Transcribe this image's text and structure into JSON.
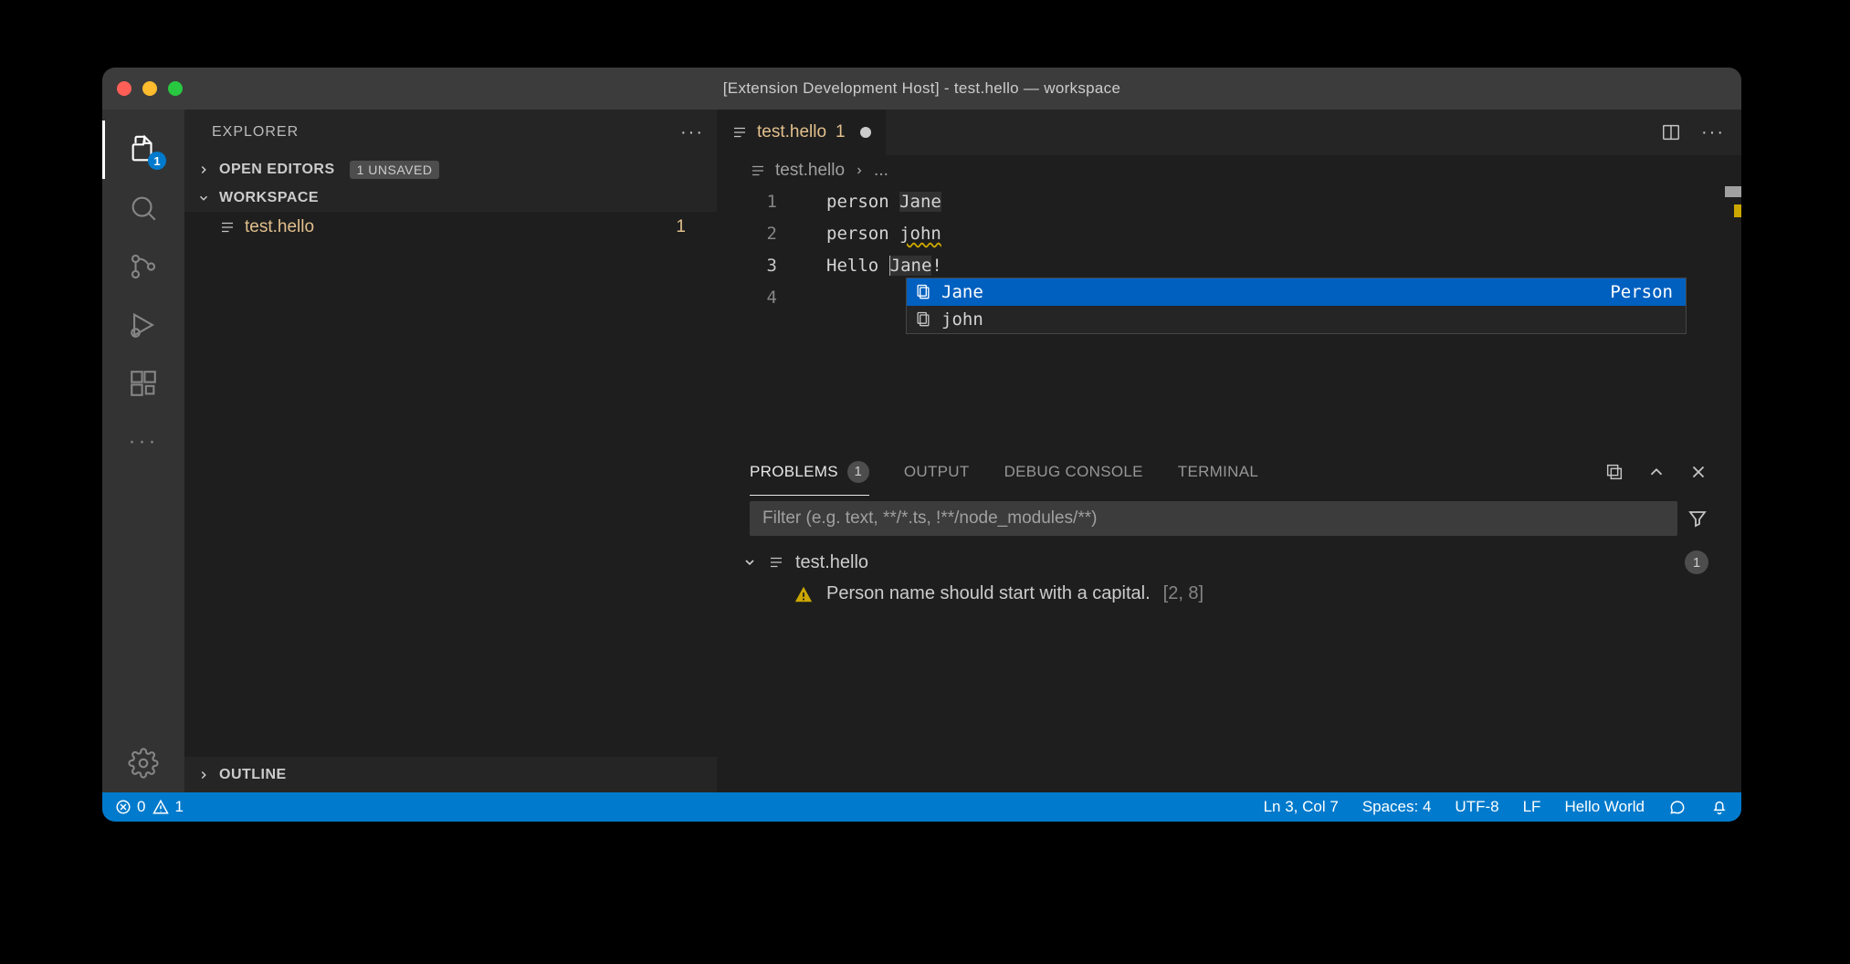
{
  "titlebar": {
    "title": "[Extension Development Host] - test.hello — workspace"
  },
  "activitybar": {
    "explorer_badge": "1"
  },
  "sidebar": {
    "title": "EXPLORER",
    "open_editors_label": "OPEN EDITORS",
    "unsaved_badge": "1 UNSAVED",
    "workspace_label": "WORKSPACE",
    "outline_label": "OUTLINE",
    "file": {
      "name": "test.hello",
      "problems": "1"
    }
  },
  "editor": {
    "tab": {
      "name": "test.hello",
      "problems": "1"
    },
    "breadcrumb": {
      "file": "test.hello",
      "more": "..."
    },
    "lines": [
      {
        "num": "1",
        "text_pre": "person ",
        "text_hl": "Jane"
      },
      {
        "num": "2",
        "text_pre": "person ",
        "text_warn": "john"
      },
      {
        "num": "3",
        "text_pre": "Hello ",
        "text_name": "Jane",
        "text_post": "!"
      },
      {
        "num": "4",
        "text_pre": ""
      }
    ],
    "suggest": {
      "items": [
        {
          "label": "Jane",
          "detail": "Person",
          "selected": true
        },
        {
          "label": "john",
          "detail": "",
          "selected": false
        }
      ]
    }
  },
  "panel": {
    "tabs": {
      "problems": "PROBLEMS",
      "problems_count": "1",
      "output": "OUTPUT",
      "debug": "DEBUG CONSOLE",
      "terminal": "TERMINAL"
    },
    "filter_placeholder": "Filter (e.g. text, **/*.ts, !**/node_modules/**)",
    "group": {
      "file": "test.hello",
      "count": "1"
    },
    "problem": {
      "message": "Person name should start with a capital.",
      "location": "[2, 8]"
    }
  },
  "statusbar": {
    "errors": "0",
    "warnings": "1",
    "cursor": "Ln 3, Col 7",
    "spaces": "Spaces: 4",
    "encoding": "UTF-8",
    "eol": "LF",
    "language": "Hello World"
  }
}
